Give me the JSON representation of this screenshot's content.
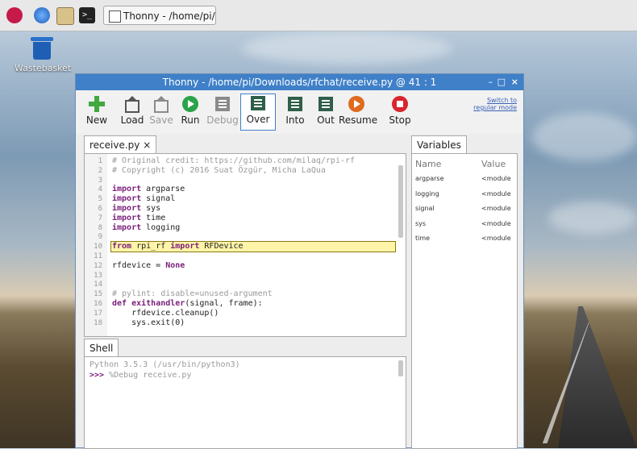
{
  "taskbar": {
    "window_button": "Thonny - /home/pi/..."
  },
  "desktop": {
    "trash_label": "Wastebasket"
  },
  "window": {
    "title": "Thonny - /home/pi/Downloads/rfchat/receive.py @ 41 : 1",
    "controls": [
      "–",
      "□",
      "×"
    ]
  },
  "toolbar": {
    "buttons": [
      {
        "label": "New",
        "icon": "plus-icon",
        "color": "#3fa83f",
        "enabled": true
      },
      {
        "label": "Load",
        "icon": "load-icon",
        "color": "#555555",
        "enabled": true
      },
      {
        "label": "Save",
        "icon": "save-icon",
        "color": "#8a8a8a",
        "enabled": false
      },
      {
        "label": "Run",
        "icon": "play-icon",
        "color": "#2aa34b",
        "enabled": true
      },
      {
        "label": "Debug",
        "icon": "debug-icon",
        "color": "#8a8a8a",
        "enabled": false
      },
      {
        "label": "Over",
        "icon": "step-over-icon",
        "color": "#2f5f4a",
        "enabled": true,
        "selected": true
      },
      {
        "label": "Into",
        "icon": "step-into-icon",
        "color": "#2f5f4a",
        "enabled": true
      },
      {
        "label": "Out",
        "icon": "step-out-icon",
        "color": "#2f5f4a",
        "enabled": true
      },
      {
        "label": "Resume",
        "icon": "resume-icon",
        "color": "#e06a1e",
        "enabled": true
      },
      {
        "label": "Stop",
        "icon": "stop-icon",
        "color": "#d9252d",
        "enabled": true
      }
    ],
    "switch_line1": "Switch to",
    "switch_line2": "regular mode"
  },
  "editor": {
    "tab_label": "receive.py ×",
    "lines": [
      {
        "n": "1",
        "parts": [
          {
            "t": "# Original credit: https://github.com/milaq/rpi-rf",
            "c": "cm"
          }
        ]
      },
      {
        "n": "2",
        "parts": [
          {
            "t": "# Copyright (c) 2016 Suat Özgür, Micha LaQua",
            "c": "cm"
          }
        ]
      },
      {
        "n": "3",
        "parts": []
      },
      {
        "n": "4",
        "parts": [
          {
            "t": "import",
            "c": "kw"
          },
          {
            "t": " argparse",
            "c": ""
          }
        ]
      },
      {
        "n": "5",
        "parts": [
          {
            "t": "import",
            "c": "kw"
          },
          {
            "t": " signal",
            "c": ""
          }
        ]
      },
      {
        "n": "6",
        "parts": [
          {
            "t": "import",
            "c": "kw"
          },
          {
            "t": " sys",
            "c": ""
          }
        ]
      },
      {
        "n": "7",
        "parts": [
          {
            "t": "import",
            "c": "kw"
          },
          {
            "t": " time",
            "c": ""
          }
        ]
      },
      {
        "n": "8",
        "parts": [
          {
            "t": "import",
            "c": "kw"
          },
          {
            "t": " logging",
            "c": ""
          }
        ]
      },
      {
        "n": "9",
        "parts": []
      },
      {
        "n": "10",
        "parts": [
          {
            "t": "from",
            "c": "kw"
          },
          {
            "t": " rpi_rf ",
            "c": ""
          },
          {
            "t": "import",
            "c": "kw"
          },
          {
            "t": " RFDevice",
            "c": ""
          }
        ]
      },
      {
        "n": "11",
        "parts": []
      },
      {
        "n": "12",
        "parts": [
          {
            "t": "rfdevice = ",
            "c": ""
          },
          {
            "t": "None",
            "c": "kw"
          }
        ]
      },
      {
        "n": "13",
        "parts": []
      },
      {
        "n": "14",
        "parts": []
      },
      {
        "n": "15",
        "parts": [
          {
            "t": "# pylint: disable=unused-argument",
            "c": "cm"
          }
        ]
      },
      {
        "n": "16",
        "parts": [
          {
            "t": "def",
            "c": "kw"
          },
          {
            "t": " ",
            "c": ""
          },
          {
            "t": "exithandler",
            "c": "kw"
          },
          {
            "t": "(signal, frame):",
            "c": ""
          }
        ]
      },
      {
        "n": "17",
        "parts": [
          {
            "t": "    rfdevice.cleanup()",
            "c": ""
          }
        ]
      },
      {
        "n": "18",
        "parts": [
          {
            "t": "    sys.exit(0)",
            "c": ""
          }
        ]
      }
    ],
    "highlight_line": 10
  },
  "variables": {
    "tab_label": "Variables",
    "col_name": "Name",
    "col_value": "Value",
    "rows": [
      {
        "name": "argparse",
        "value": "<module"
      },
      {
        "name": "logging",
        "value": "<module"
      },
      {
        "name": "signal",
        "value": "<module"
      },
      {
        "name": "sys",
        "value": "<module"
      },
      {
        "name": "time",
        "value": "<module"
      }
    ]
  },
  "shell": {
    "tab_label": "Shell",
    "banner": "Python 3.5.3 (/usr/bin/python3)",
    "prompt": ">>>",
    "command": " %Debug receive.py"
  }
}
